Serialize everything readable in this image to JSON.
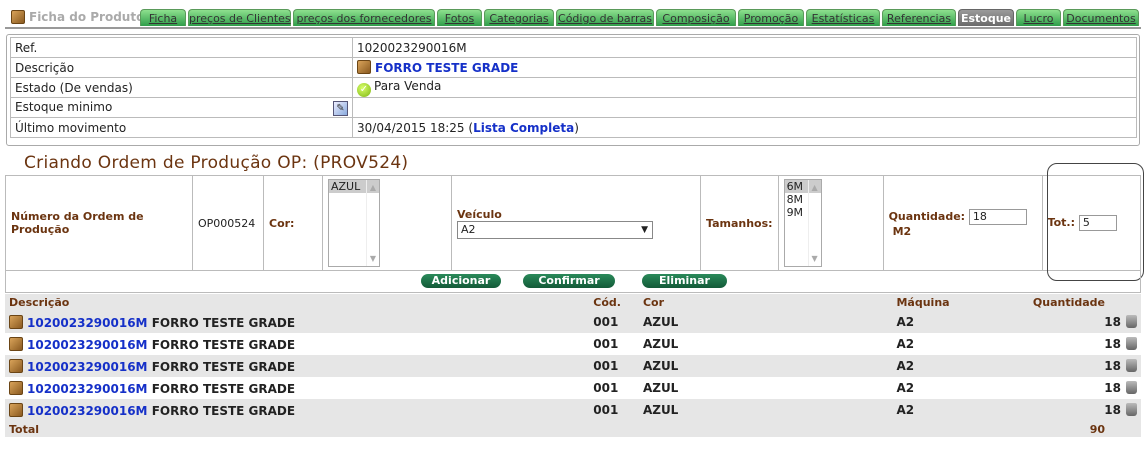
{
  "tabs": {
    "home": "Ficha do Produto",
    "items": [
      "Ficha",
      "preços de Clientes",
      "preços dos fornecedores",
      "Fotos",
      "Categorias",
      "Código de barras",
      "Composição",
      "Promoção",
      "Estatísticas",
      "Referencias",
      "Estoque",
      "Lucro",
      "Documentos"
    ],
    "active": "Estoque"
  },
  "info": {
    "ref_label": "Ref.",
    "ref_value": "1020023290016M",
    "desc_label": "Descrição",
    "desc_value": "FORRO TESTE GRADE",
    "estado_label": "Estado (De vendas)",
    "estado_value": "Para Venda",
    "minimo_label": "Estoque minimo",
    "ultimo_label": "Último movimento",
    "ultimo_date": "30/04/2015 18:25",
    "ultimo_open": "(",
    "ultimo_link": "Lista Completa",
    "ultimo_close": ")"
  },
  "op": {
    "title": "Criando Ordem de Produção OP: (PROV524)",
    "numero_label": "Número da Ordem de Produção",
    "numero_value": "OP000524",
    "cor_label": "Cor:",
    "cor_options": [
      "AZUL"
    ],
    "veiculo_label": "Veículo",
    "veiculo_value": "A2",
    "tamanhos_label": "Tamanhos:",
    "tamanhos_options": [
      "6M",
      "8M",
      "9M"
    ],
    "quantidade_label": "Quantidade:",
    "quantidade_value": "18",
    "unit": "M2",
    "tot_label": "Tot.:",
    "tot_value": "5",
    "buttons": {
      "add": "Adicionar",
      "confirm": "Confirmar",
      "remove": "Eliminar"
    }
  },
  "list": {
    "headers": {
      "descricao": "Descrição",
      "cod": "Cód.",
      "cor": "Cor",
      "maquina": "Máquina",
      "quantidade": "Quantidade"
    },
    "rows": [
      {
        "ref": "1020023290016M",
        "name": "FORRO TESTE GRADE",
        "cod": "001",
        "cor": "AZUL",
        "maquina": "A2",
        "qty": "18"
      },
      {
        "ref": "1020023290016M",
        "name": "FORRO TESTE GRADE",
        "cod": "001",
        "cor": "AZUL",
        "maquina": "A2",
        "qty": "18"
      },
      {
        "ref": "1020023290016M",
        "name": "FORRO TESTE GRADE",
        "cod": "001",
        "cor": "AZUL",
        "maquina": "A2",
        "qty": "18"
      },
      {
        "ref": "1020023290016M",
        "name": "FORRO TESTE GRADE",
        "cod": "001",
        "cor": "AZUL",
        "maquina": "A2",
        "qty": "18"
      },
      {
        "ref": "1020023290016M",
        "name": "FORRO TESTE GRADE",
        "cod": "001",
        "cor": "AZUL",
        "maquina": "A2",
        "qty": "18"
      }
    ],
    "total_label": "Total",
    "total_value": "90"
  }
}
